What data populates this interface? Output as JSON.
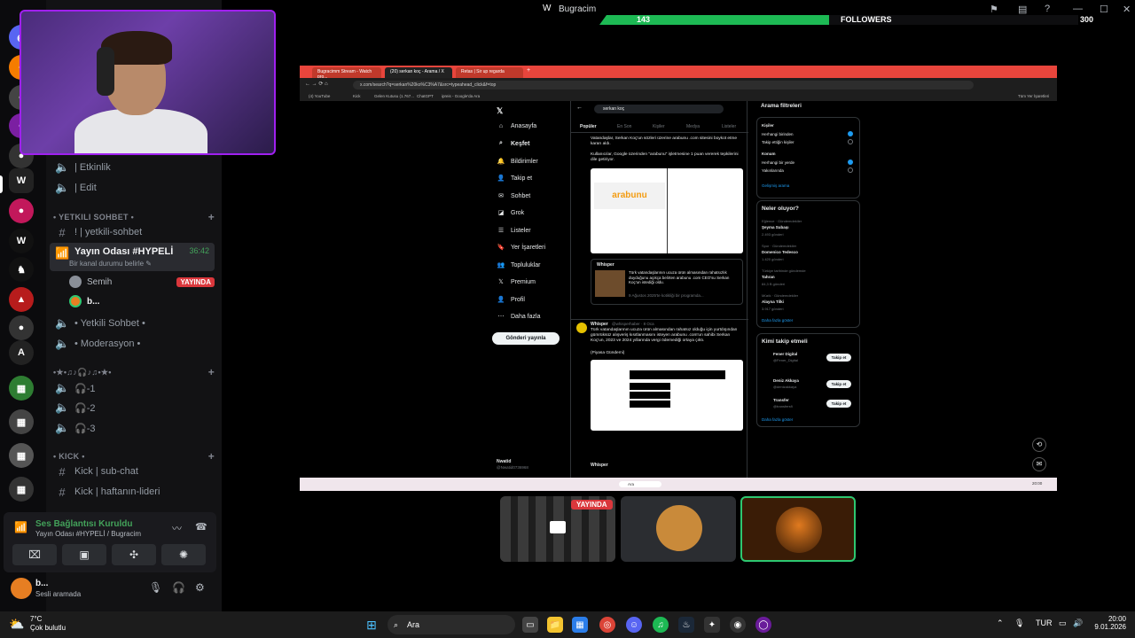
{
  "topbar": {
    "title": "Bugracim",
    "followers_current": "143",
    "followers_label": "FOLLOWERS",
    "followers_goal": "300",
    "followers_progress": 0.48
  },
  "sidebar": {
    "channels_top": [
      {
        "label": "| Etkinlik",
        "icon": "speaker-icon"
      },
      {
        "label": "| Edit",
        "icon": "speaker-icon"
      }
    ],
    "category_yetkili": "• YETKILI SOHBET •",
    "yetkili_text_channel": "! | yetkili-sohbet",
    "voice_channel": {
      "name": "Yayın Odası #HYPELİ",
      "timer": "36:42",
      "status": "Bir kanal durumu belirle",
      "users": [
        {
          "name": "Semih",
          "badge": "YAYINDA"
        },
        {
          "name": "b..."
        }
      ]
    },
    "voice_channels_more": [
      "• Yetkili Sohbet •",
      "• Moderasyon •"
    ],
    "category_music": "•★•♫♪🎧♪♫•★• ",
    "music_channels": [
      "🎧-1",
      "🎧-2",
      "🎧-3"
    ],
    "category_kick": "• KICK •",
    "kick_channels": [
      "Kick | sub-chat",
      "Kick | haftanın-lideri"
    ]
  },
  "voice_panel": {
    "status": "Ses Bağlantısı Kuruldu",
    "channel": "Yayın Odası #HYPELİ / Bugracim"
  },
  "user_panel": {
    "name": "b...",
    "status": "Sesli aramada"
  },
  "stream": {
    "browser": {
      "tabs": [
        "Bugracimm Stream - Watch pro...",
        "(20) serkan koç - Arama / X",
        "Retas | Sir up regarda"
      ],
      "url": "x.com/search?q=serkan%20ko%C3%A7&src=typeahead_click&f=top",
      "bookmarks": [
        "(4) YouTube",
        "Kick",
        "Gelen Kutusu (1.767...",
        "ChatGPT",
        "ipreis - Google'da Ara",
        "Tüm Yer İşaretleri"
      ]
    },
    "x_nav": [
      "Anasayfa",
      "Keşfet",
      "Bildirimler",
      "Takip et",
      "Sohbet",
      "Grok",
      "Listeler",
      "Yer İşaretleri",
      "Topluluklar",
      "Premium",
      "Profil",
      "Daha fazla"
    ],
    "x_post_button": "Gönderi yayınla",
    "x_account": {
      "name": "Nwatid",
      "handle": "@Nwatid0736968"
    },
    "search_query": "serkan koç",
    "feed_tabs": [
      "Popüler",
      "En Son",
      "Kişiler",
      "Medya",
      "Listeler"
    ],
    "feed_texts": [
      "Vatandaşlar, Serkan Koç'un sözleri üzerine arabunu .com sitesini boykot etme kararı aldı.",
      "Kullanıcılar, Google üzerinden \"arabunu\" işletmesine 1 puan vererek tepkilerini dile getiriyor.",
      "Türk vatandaşlarının ucuza ürün almasından rahatsızlık duyduğunu açıkça belirten arabunu .com CEO'su Serkan Koç'un istediği oldu.",
      "9 Ağustos 2025'te kotikliği bir programda...",
      "Türk vatandaşlarının ucuza ürün almasından rahatsız olduğu için yurtdışından gümrüksüz alışveriş kısıtlanmasını isteyen arabunu .com'un sahibi Serkan Koç'un, 2023 ve 2024 yıllarında vergi ödemediği ortaya çıktı.",
      "(Piyasa Gündemi)"
    ],
    "card_brand": "arabunu",
    "post_author": "Whisper",
    "post_handle": "@whisperhaber · 8 Oca",
    "search_filters": {
      "title": "Arama filtreleri",
      "people_title": "Kişiler",
      "people_opts": [
        "Herhangi birinden",
        "Takip ettiğin kişiler"
      ],
      "loc_title": "Konum",
      "loc_opts": [
        "Herhangi bir yerde",
        "Yakınlarında"
      ],
      "advanced": "Gelişmiş arama"
    },
    "trends": {
      "title": "Neler oluyor?",
      "items": [
        {
          "meta": "Eğlence · Gündemdekiler",
          "name": "Şeyma Subaşı",
          "count": "2.493 gönderi"
        },
        {
          "meta": "Spor · Gündemdekiler",
          "name": "Domenico Tedesco",
          "count": "1.420 gönderi"
        },
        {
          "meta": "Türkiye tarihinde gündemde",
          "name": "Tahran",
          "count": "84,3 B gönderi"
        },
        {
          "meta": "Müzik · Gündemdekiler",
          "name": "Alayna Tilki",
          "count": "3.917 gönderi"
        }
      ],
      "more": "Daha fazla göster"
    },
    "who_to_follow": {
      "title": "Kimi takip etmeli",
      "items": [
        {
          "name": "Fener Digital",
          "handle": "@Fener_Digital"
        },
        {
          "name": "Deniz Akkaya",
          "handle": "@denizakkaya"
        },
        {
          "name": "Transfer",
          "handle": "@transfersfi"
        }
      ],
      "button": "Takip et",
      "more": "Daha fazla göster"
    },
    "mini_taskbar_search": "Ara",
    "mini_clock": "20:00"
  },
  "tiles": [
    {
      "label": "YAYINDA"
    }
  ],
  "taskbar": {
    "temp": "7°C",
    "weather": "Çok bulutlu",
    "search": "Ara",
    "lang": "TUR",
    "time": "20:00",
    "date": "9.01.2026"
  },
  "colors": {
    "accent_green": "#1db954",
    "live_red": "#da373c",
    "webcam_border": "#a020f0",
    "x_bg": "#000000",
    "discord_bg": "#121214"
  }
}
